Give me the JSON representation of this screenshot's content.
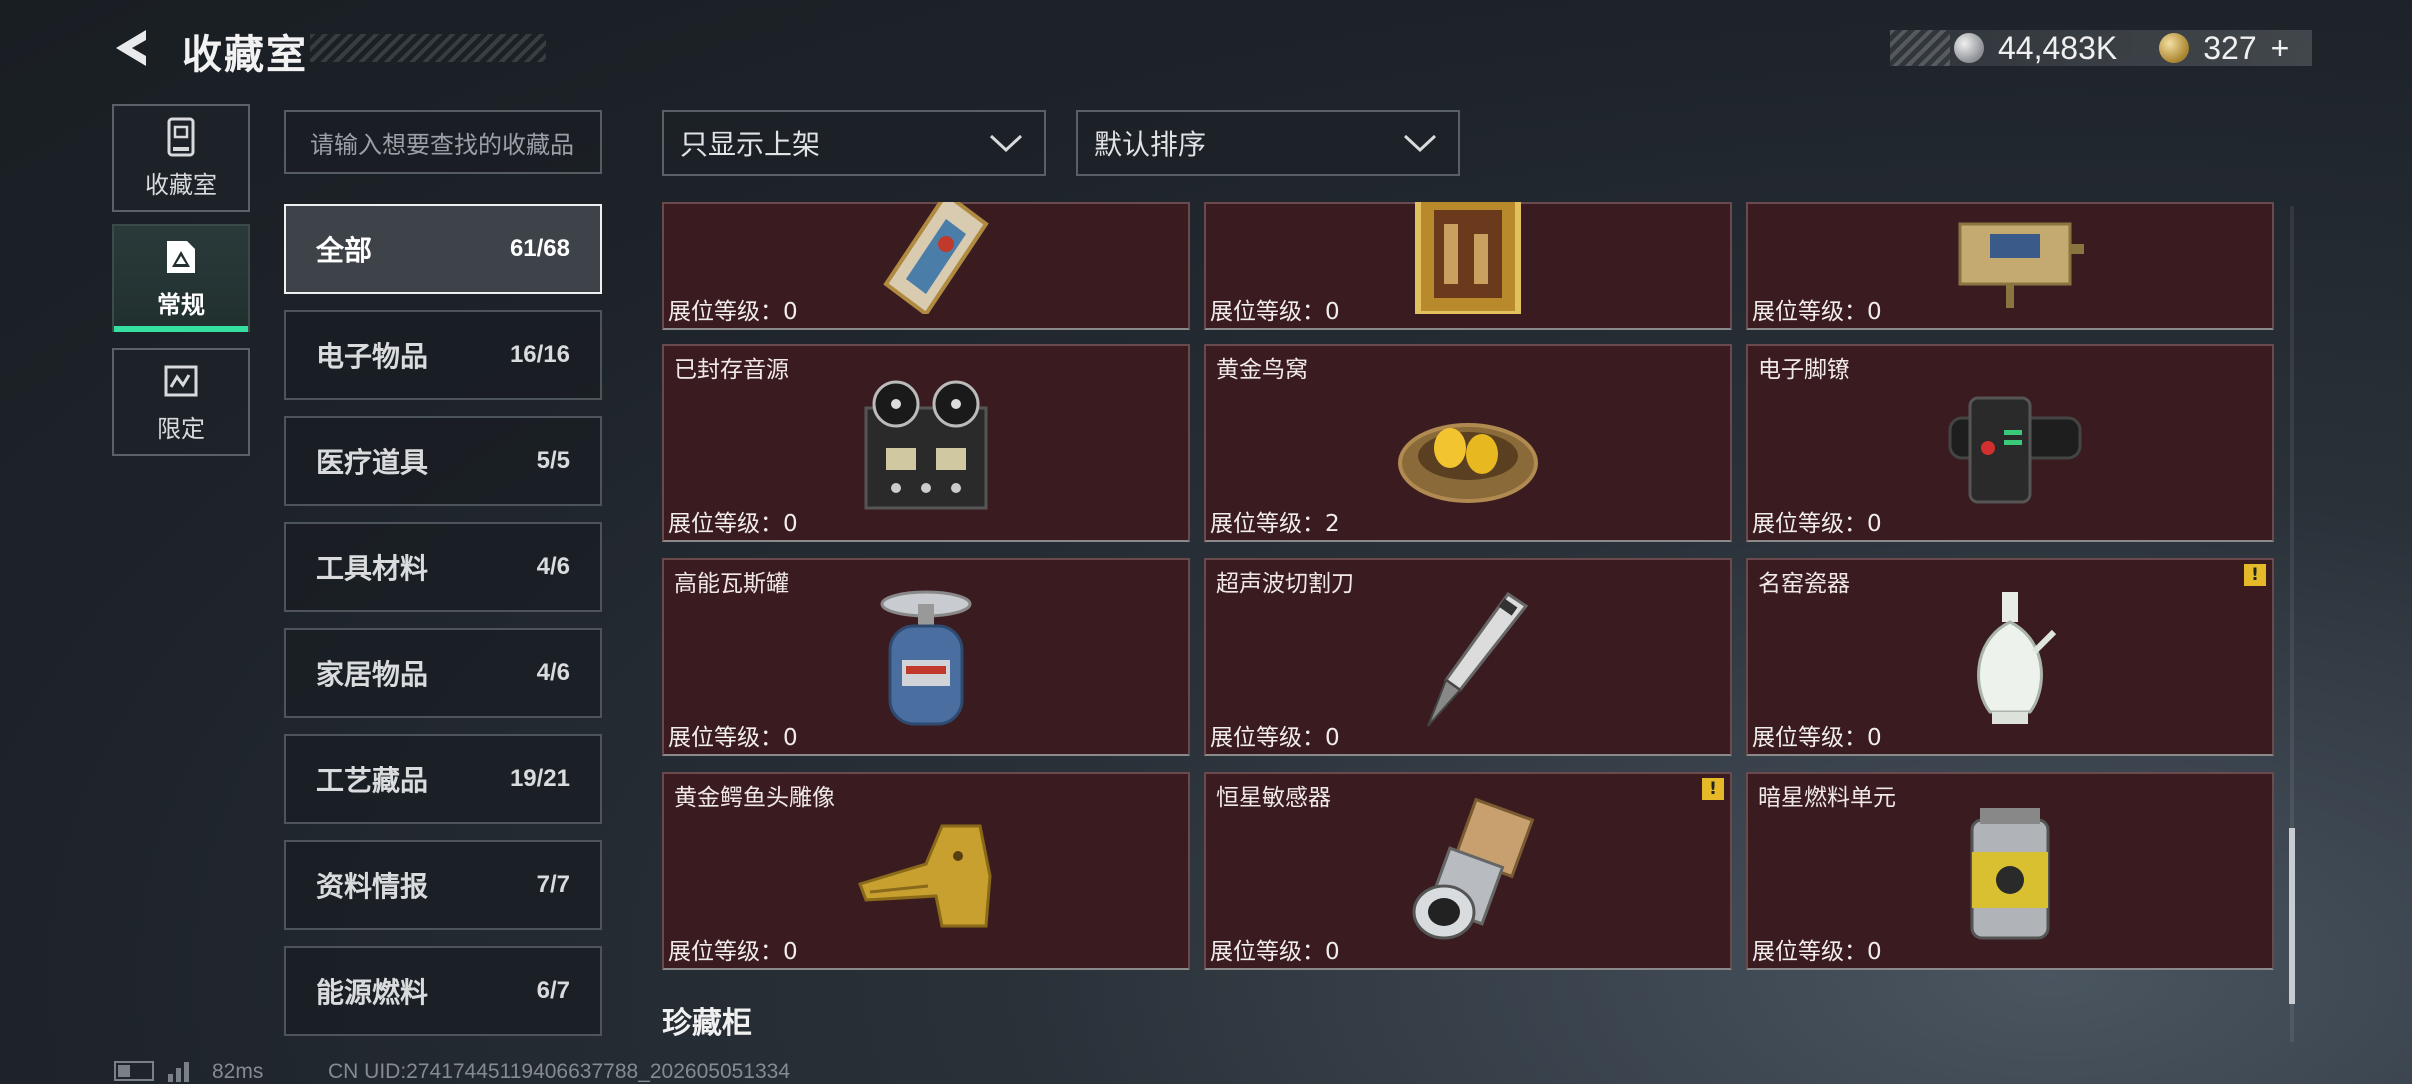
{
  "header": {
    "title": "收藏室"
  },
  "currency": {
    "silver": "44,483K",
    "gold": "327",
    "gold_add": "+"
  },
  "side_nav": [
    {
      "label": "收藏室",
      "icon": "trophy-cabinet-icon",
      "active": false
    },
    {
      "label": "常规",
      "icon": "regular-collection-icon",
      "active": true
    },
    {
      "label": "限定",
      "icon": "limited-collection-icon",
      "active": false
    }
  ],
  "search": {
    "placeholder": "请输入想要查找的收藏品"
  },
  "categories": [
    {
      "name": "全部",
      "count": "61/68",
      "active": true
    },
    {
      "name": "电子物品",
      "count": "16/16"
    },
    {
      "name": "医疗道具",
      "count": "5/5"
    },
    {
      "name": "工具材料",
      "count": "4/6"
    },
    {
      "name": "家居物品",
      "count": "4/6"
    },
    {
      "name": "工艺藏品",
      "count": "19/21"
    },
    {
      "name": "资料情报",
      "count": "7/7"
    },
    {
      "name": "能源燃料",
      "count": "6/7"
    }
  ],
  "filters": {
    "shelf_filter": "只显示上架",
    "sort": "默认排序"
  },
  "items": [
    {
      "name": "",
      "level": "展位等级：0",
      "art": "jeweled-tablet"
    },
    {
      "name": "",
      "level": "展位等级：0",
      "art": "framed-painting"
    },
    {
      "name": "",
      "level": "展位等级：0",
      "art": "circuit-device"
    },
    {
      "name": "已封存音源",
      "level": "展位等级：0",
      "art": "reel-recorder"
    },
    {
      "name": "黄金鸟窝",
      "level": "展位等级：2",
      "art": "golden-nest"
    },
    {
      "name": "电子脚镣",
      "level": "展位等级：0",
      "art": "ankle-monitor"
    },
    {
      "name": "高能瓦斯罐",
      "level": "展位等级：0",
      "art": "gas-canister"
    },
    {
      "name": "超声波切割刀",
      "level": "展位等级：0",
      "art": "ultrasonic-knife"
    },
    {
      "name": "名窑瓷器",
      "level": "展位等级：0",
      "art": "porcelain-vase",
      "warn": "!"
    },
    {
      "name": "黄金鳄鱼头雕像",
      "level": "展位等级：0",
      "art": "gold-croc-statue"
    },
    {
      "name": "恒星敏感器",
      "level": "展位等级：0",
      "art": "star-sensor",
      "warn": "!"
    },
    {
      "name": "暗星燃料单元",
      "level": "展位等级：0",
      "art": "fuel-cell"
    }
  ],
  "section": {
    "title": "珍藏柜"
  },
  "status": {
    "ping": "82ms",
    "uid": "CN UID:27417445119406637788_202605051334"
  }
}
